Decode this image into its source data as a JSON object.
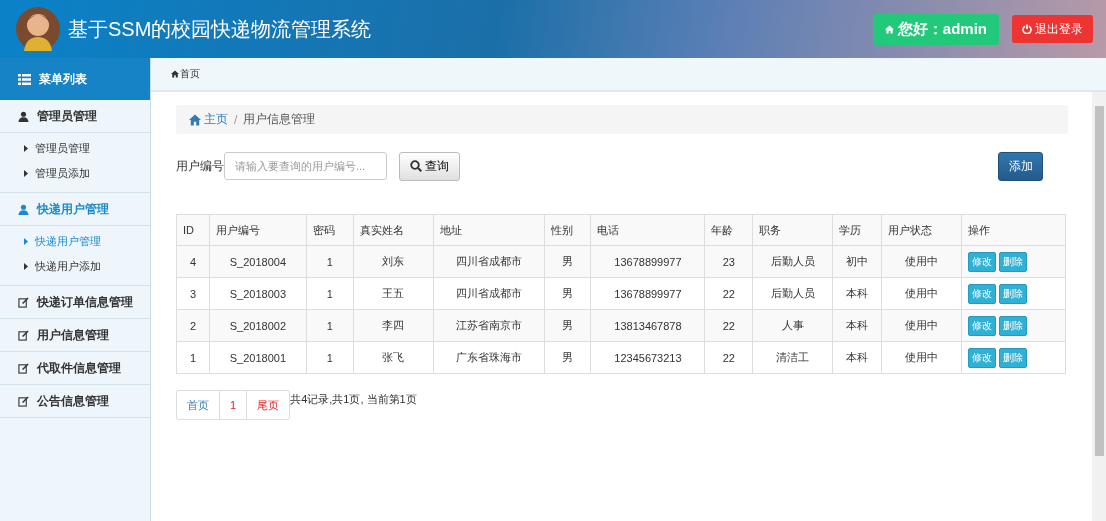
{
  "header": {
    "title": "基于SSM的校园快递物流管理系统",
    "greeting": "您好：admin",
    "logout": "退出登录"
  },
  "sidebar": {
    "title": "菜单列表",
    "groups": [
      {
        "label": "管理员管理",
        "kind": "user",
        "selected": false,
        "items": [
          {
            "label": "管理员管理",
            "selected": false
          },
          {
            "label": "管理员添加",
            "selected": false
          }
        ]
      },
      {
        "label": "快递用户管理",
        "kind": "user",
        "selected": true,
        "items": [
          {
            "label": "快递用户管理",
            "selected": true
          },
          {
            "label": "快递用户添加",
            "selected": false
          }
        ]
      },
      {
        "label": "快递订单信息管理",
        "kind": "edit",
        "selected": false
      },
      {
        "label": "用户信息管理",
        "kind": "edit",
        "selected": false
      },
      {
        "label": "代取件信息管理",
        "kind": "edit",
        "selected": false
      },
      {
        "label": "公告信息管理",
        "kind": "edit",
        "selected": false
      }
    ]
  },
  "tab_bar": {
    "tab": "首页"
  },
  "breadcrumb": {
    "home": "主页",
    "separator": "/",
    "current": "用户信息管理"
  },
  "search": {
    "label": "用户编号",
    "placeholder": "请输入要查询的用户编号...",
    "button": "查询"
  },
  "add_button": "添加",
  "table": {
    "columns": [
      "ID",
      "用户编号",
      "密码",
      "真实姓名",
      "地址",
      "性别",
      "电话",
      "年龄",
      "职务",
      "学历",
      "用户状态",
      "操作"
    ],
    "rows": [
      {
        "cells": [
          "4",
          "S_2018004",
          "1",
          "刘东",
          "四川省成都市",
          "男",
          "13678899977",
          "23",
          "后勤人员",
          "初中",
          "使用中"
        ],
        "actions": [
          "修改",
          "删除"
        ]
      },
      {
        "cells": [
          "3",
          "S_2018003",
          "1",
          "王五",
          "四川省成都市",
          "男",
          "13678899977",
          "22",
          "后勤人员",
          "本科",
          "使用中"
        ],
        "actions": [
          "修改",
          "删除"
        ]
      },
      {
        "cells": [
          "2",
          "S_2018002",
          "1",
          "李四",
          "江苏省南京市",
          "男",
          "13813467878",
          "22",
          "人事",
          "本科",
          "使用中"
        ],
        "actions": [
          "修改",
          "删除"
        ]
      },
      {
        "cells": [
          "1",
          "S_2018001",
          "1",
          "张飞",
          "广东省珠海市",
          "男",
          "12345673213",
          "22",
          "清洁工",
          "本科",
          "使用中"
        ],
        "actions": [
          "修改",
          "删除"
        ]
      }
    ]
  },
  "pagination": {
    "pages": [
      {
        "label": "首页",
        "kind": "first"
      },
      {
        "label": "1",
        "kind": "current"
      },
      {
        "label": "尾页",
        "kind": "last"
      }
    ],
    "summary": "共4记录,共1页, 当前第1页"
  }
}
